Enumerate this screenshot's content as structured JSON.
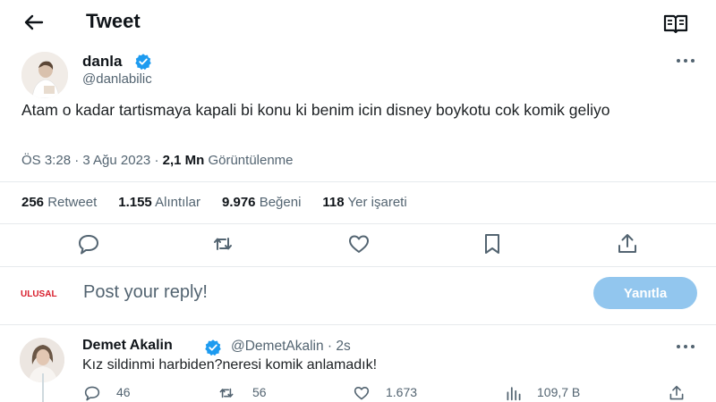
{
  "header": {
    "title": "Tweet",
    "back_icon": "arrow-left-icon",
    "reader_icon": "reader-mode-icon"
  },
  "tweet": {
    "author_name": "danla",
    "author_handle": "@danlabilic",
    "verified": true,
    "text": "Atam o kadar tartismaya kapali bi konu ki benim icin disney boykotu cok komik geliyo",
    "time": "ÖS 3:28 · 3 Ağu 2023 · ",
    "views_count": "2,1 Mn",
    "views_label": " Görüntülenme"
  },
  "stats": [
    {
      "count": "256",
      "label": "Retweet"
    },
    {
      "count": "1.155",
      "label": "Alıntılar"
    },
    {
      "count": "9.976",
      "label": "Beğeni"
    },
    {
      "count": "118",
      "label": "Yer işareti"
    }
  ],
  "actions": [
    "reply-icon",
    "retweet-icon",
    "like-icon",
    "bookmark-icon",
    "share-icon"
  ],
  "composer": {
    "logo_text": "ULUSAL",
    "placeholder": "Post your reply!",
    "button_label": "Yanıtla"
  },
  "reply": {
    "author_name": "Demet Akalin",
    "author_handle": "@DemetAkalin · 2s",
    "text": "Kız sildinmi harbiden?neresi komik anlamadık!",
    "replies": "46",
    "retweets": "56",
    "likes": "1.673",
    "views": "109,7 B"
  },
  "colors": {
    "accent": "#1d9bf0",
    "reply_button": "#92c6ee",
    "muted_text": "#536471",
    "logo_red": "#d81e2c"
  }
}
